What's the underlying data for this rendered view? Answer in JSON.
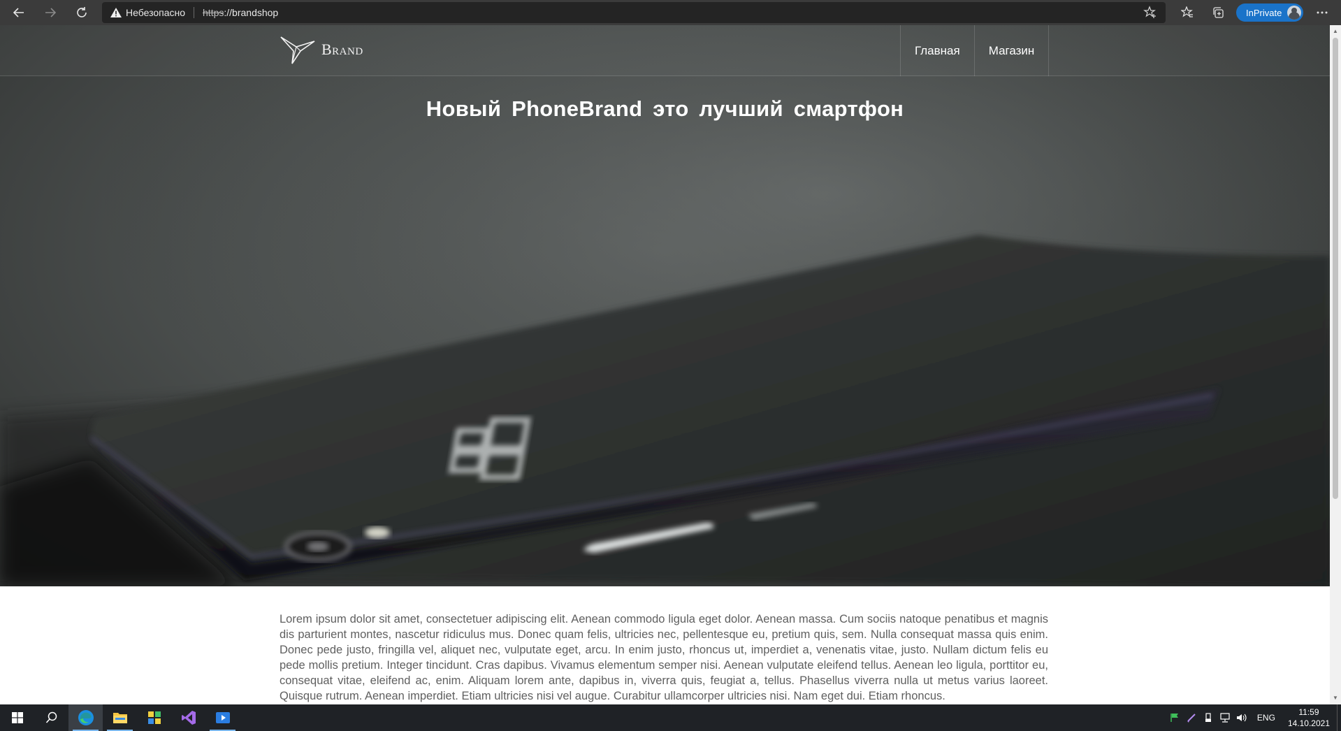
{
  "browser": {
    "security_label": "Небезопасно",
    "url_scheme": "https",
    "url_rest": "://brandshop",
    "inprivate_label": "InPrivate"
  },
  "site": {
    "logo_text": "Brand",
    "nav": [
      {
        "label": "Главная"
      },
      {
        "label": "Магазин"
      }
    ],
    "hero_title": "Новый PhoneBrand это лучший смартфон",
    "body_text": "Lorem ipsum dolor sit amet, consectetuer adipiscing elit. Aenean commodo ligula eget dolor. Aenean massa. Cum sociis natoque penatibus et magnis dis parturient montes, nascetur ridiculus mus. Donec quam felis, ultricies nec, pellentesque eu, pretium quis, sem. Nulla consequat massa quis enim. Donec pede justo, fringilla vel, aliquet nec, vulputate eget, arcu. In enim justo, rhoncus ut, imperdiet a, venenatis vitae, justo. Nullam dictum felis eu pede mollis pretium. Integer tincidunt. Cras dapibus. Vivamus elementum semper nisi. Aenean vulputate eleifend tellus. Aenean leo ligula, porttitor eu, consequat vitae, eleifend ac, enim. Aliquam lorem ante, dapibus in, viverra quis, feugiat a, tellus. Phasellus viverra nulla ut metus varius laoreet. Quisque rutrum. Aenean imperdiet. Etiam ultricies nisi vel augue. Curabitur ullamcorper ultricies nisi. Nam eget dui. Etiam rhoncus."
  },
  "taskbar": {
    "language": "ENG",
    "time": "11:59",
    "date": "14.10.2021"
  },
  "colors": {
    "accent": "#1a73c9",
    "hero_bg": "#4e5251"
  }
}
